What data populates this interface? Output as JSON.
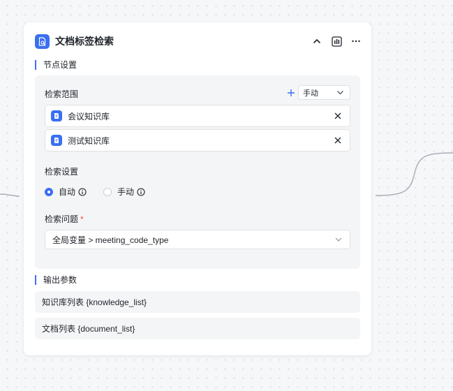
{
  "node": {
    "title": "文档标签检索",
    "icon": "document-search-icon",
    "actions": [
      "collapse-icon",
      "chart-icon",
      "more-icon"
    ]
  },
  "node_settings": {
    "section_title": "节点设置",
    "search_scope": {
      "label": "检索范围",
      "mode": "手动",
      "items": [
        {
          "name": "会议知识库",
          "icon": "knowledge-base-icon"
        },
        {
          "name": "测试知识库",
          "icon": "knowledge-base-icon"
        }
      ]
    },
    "search_settings": {
      "label": "检索设置",
      "options": [
        {
          "label": "自动",
          "checked": true
        },
        {
          "label": "手动",
          "checked": false
        }
      ]
    },
    "search_query": {
      "label": "检索问题",
      "required_mark": "*",
      "value": "全局变量 > meeting_code_type"
    }
  },
  "output": {
    "section_title": "输出参数",
    "params": [
      "知识库列表 {knowledge_list}",
      "文档列表 {document_list}"
    ]
  },
  "colors": {
    "accent": "#3a6ff0",
    "required": "#f54a45",
    "panel": "#f4f5f7",
    "edge": "#a9aeb8"
  }
}
